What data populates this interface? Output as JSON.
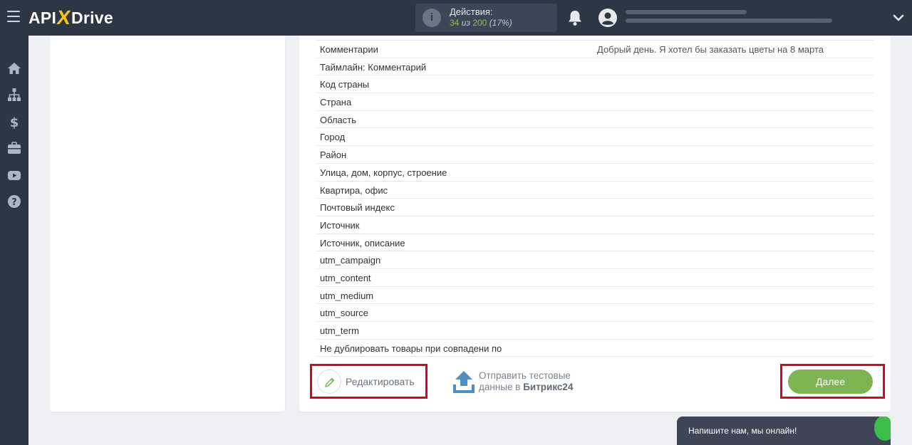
{
  "header": {
    "logo_api": "API",
    "logo_x": "X",
    "logo_drive": "Drive",
    "actions_title": "Действия:",
    "actions_used": "34",
    "actions_of": "из",
    "actions_total": "200",
    "actions_pct": "(17%)"
  },
  "sidebar": {
    "items": [
      "home-icon",
      "sitemap-icon",
      "dollar-icon",
      "briefcase-icon",
      "youtube-icon",
      "help-icon"
    ]
  },
  "fields": [
    {
      "label": "",
      "value": ""
    },
    {
      "label": "Комментарии",
      "value": "Добрый день. Я хотел бы заказать цветы на 8 марта"
    },
    {
      "label": "Таймлайн: Комментарий",
      "value": ""
    },
    {
      "label": "Код страны",
      "value": ""
    },
    {
      "label": "Страна",
      "value": ""
    },
    {
      "label": "Область",
      "value": ""
    },
    {
      "label": "Город",
      "value": ""
    },
    {
      "label": "Район",
      "value": ""
    },
    {
      "label": "Улица, дом, корпус, строение",
      "value": ""
    },
    {
      "label": "Квартира, офис",
      "value": ""
    },
    {
      "label": "Почтовый индекс",
      "value": ""
    },
    {
      "label": "Источник",
      "value": ""
    },
    {
      "label": "Источник, описание",
      "value": ""
    },
    {
      "label": "utm_campaign",
      "value": ""
    },
    {
      "label": "utm_content",
      "value": ""
    },
    {
      "label": "utm_medium",
      "value": ""
    },
    {
      "label": "utm_source",
      "value": ""
    },
    {
      "label": "utm_term",
      "value": ""
    },
    {
      "label": "Не дублировать товары при совпадени по",
      "value": ""
    }
  ],
  "footer": {
    "edit_label": "Редактировать",
    "send_line1": "Отправить тестовые",
    "send_line2_prefix": "данные в ",
    "send_line2_bold": "Битрикс24",
    "next_label": "Далее"
  },
  "chat": {
    "text": "Напишите нам, мы онлайн!"
  },
  "colors": {
    "topbar": "#2d3644",
    "accent_green": "#7db552",
    "highlight": "#e3001b",
    "logo_x": "#f5c518"
  }
}
